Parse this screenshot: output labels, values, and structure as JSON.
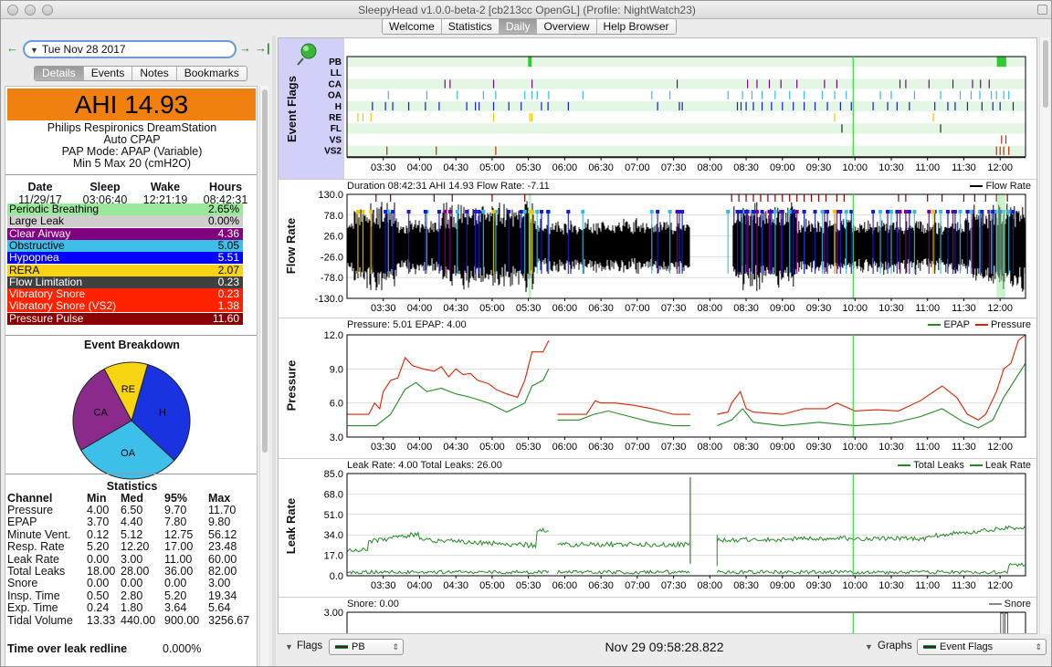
{
  "window": {
    "title": "SleepyHead v1.0.0-beta-2 [cb213cc OpenGL] (Profile: NightWatch23)"
  },
  "top_tabs": [
    {
      "label": "Welcome",
      "active": false
    },
    {
      "label": "Statistics",
      "active": false
    },
    {
      "label": "Daily",
      "active": true
    },
    {
      "label": "Overview",
      "active": false
    },
    {
      "label": "Help Browser",
      "active": false
    }
  ],
  "nav": {
    "date": "Tue Nov 28 2017",
    "back_icon": "arrow-left-icon",
    "forward_icon": "arrow-right-icon",
    "last_icon": "arrow-to-end-icon"
  },
  "left_tabs": [
    {
      "label": "Details",
      "active": true
    },
    {
      "label": "Events",
      "active": false
    },
    {
      "label": "Notes",
      "active": false
    },
    {
      "label": "Bookmarks",
      "active": false
    }
  ],
  "summary": {
    "ahi": "AHI 14.93",
    "ahi_color": "#f08010",
    "machine": "Philips Respironics DreamStation",
    "mode_type": "Auto CPAP",
    "pap_mode": "PAP Mode: APAP (Variable)",
    "pressure_range": "Min 5 Max 20 (cmH2O)"
  },
  "session": {
    "headers": [
      "Date",
      "Sleep",
      "Wake",
      "Hours"
    ],
    "values": [
      "11/29/17",
      "03:06:40",
      "12:21:19",
      "08:42:31"
    ]
  },
  "events": [
    {
      "label": "Periodic Breathing",
      "value": "2.65%",
      "bg": "#9ae89a",
      "fg": "#000000"
    },
    {
      "label": "Large Leak",
      "value": "0.00%",
      "bg": "#cfcfcf",
      "fg": "#000000"
    },
    {
      "label": "Clear Airway",
      "value": "4.36",
      "bg": "#800080",
      "fg": "#ffffff"
    },
    {
      "label": "Obstructive",
      "value": "5.05",
      "bg": "#3cbfe8",
      "fg": "#000000"
    },
    {
      "label": "Hypopnea",
      "value": "5.51",
      "bg": "#0000ff",
      "fg": "#ffffff"
    },
    {
      "label": "RERA",
      "value": "2.07",
      "bg": "#f7d513",
      "fg": "#000000"
    },
    {
      "label": "Flow Limitation",
      "value": "0.23",
      "bg": "#404040",
      "fg": "#ffffff"
    },
    {
      "label": "Vibratory Snore",
      "value": "0.23",
      "bg": "#ff2200",
      "fg": "#ffffff"
    },
    {
      "label": "Vibratory Snore (VS2)",
      "value": "1.38",
      "bg": "#ff2200",
      "fg": "#ffffff"
    },
    {
      "label": "Pressure Pulse",
      "value": "11.60",
      "bg": "#8b0000",
      "fg": "#ffffff"
    }
  ],
  "event_breakdown": {
    "title": "Event Breakdown",
    "slices": [
      {
        "label": "H",
        "value": 5.51,
        "color": "#1a33e0"
      },
      {
        "label": "OA",
        "value": 5.05,
        "color": "#3cbfe8"
      },
      {
        "label": "CA",
        "value": 4.36,
        "color": "#8a2a8a"
      },
      {
        "label": "RE",
        "value": 2.07,
        "color": "#f7d513"
      }
    ]
  },
  "statistics": {
    "title": "Statistics",
    "headers": [
      "Channel",
      "Min",
      "Med",
      "95%",
      "Max"
    ],
    "rows": [
      [
        "Pressure",
        "4.00",
        "6.50",
        "9.70",
        "11.70"
      ],
      [
        "EPAP",
        "3.70",
        "4.40",
        "7.80",
        "9.80"
      ],
      [
        "Minute Vent.",
        "0.12",
        "5.12",
        "12.75",
        "56.12"
      ],
      [
        "Resp. Rate",
        "5.20",
        "12.20",
        "17.00",
        "23.48"
      ],
      [
        "Leak Rate",
        "0.00",
        "3.00",
        "11.00",
        "60.00"
      ],
      [
        "Total Leaks",
        "18.00",
        "28.00",
        "36.00",
        "82.00"
      ],
      [
        "Snore",
        "0.00",
        "0.00",
        "0.00",
        "3.00"
      ],
      [
        "Insp. Time",
        "0.50",
        "2.80",
        "5.20",
        "19.34"
      ],
      [
        "Exp. Time",
        "0.24",
        "1.80",
        "3.64",
        "5.64"
      ],
      [
        "Tidal Volume",
        "13.33",
        "440.00",
        "900.00",
        "3256.67"
      ]
    ],
    "leak_redline_label": "Time over leak redline",
    "leak_redline_value": "0.000%"
  },
  "time_axis": [
    "03:30",
    "04:00",
    "04:30",
    "05:00",
    "05:30",
    "06:00",
    "06:30",
    "07:00",
    "07:30",
    "08:00",
    "08:30",
    "09:00",
    "09:30",
    "10:00",
    "10:30",
    "11:00",
    "11:30",
    "12:00"
  ],
  "event_flags": {
    "title": "Event Flags",
    "pin_icon": "pushpin-icon",
    "rows": [
      {
        "label": "PB",
        "color": "#33cc33",
        "times": [
          5.52,
          11.98,
          12.02,
          12.06
        ]
      },
      {
        "label": "LL",
        "color": "#888888",
        "times": []
      },
      {
        "label": "CA",
        "color": "#800080",
        "times": [
          4.35,
          4.42,
          5.02,
          5.55,
          7.55,
          8.52,
          8.65,
          8.82,
          8.98,
          9.2,
          9.58,
          9.75,
          10.62,
          10.7,
          11.02,
          11.35,
          11.62,
          11.73,
          11.85
        ]
      },
      {
        "label": "OA",
        "color": "#33bbe0",
        "times": [
          3.57,
          4.1,
          4.52,
          4.88,
          5.05,
          5.45,
          5.55,
          5.62,
          5.78,
          6.25,
          7.2,
          7.45,
          8.25,
          8.45,
          8.58,
          8.72,
          8.9,
          9.1,
          9.3,
          9.55,
          9.72,
          9.88,
          10.35,
          10.5,
          10.82,
          11.18,
          11.45,
          11.6,
          11.72,
          11.88,
          11.95,
          12.05,
          12.12
        ]
      },
      {
        "label": "H",
        "color": "#1a1acc",
        "times": [
          3.35,
          3.53,
          3.63,
          3.85,
          4.08,
          4.27,
          4.65,
          4.77,
          4.82,
          5.02,
          5.23,
          5.4,
          5.68,
          5.77,
          6.05,
          7.28,
          7.58,
          7.62,
          8.38,
          8.43,
          8.5,
          8.6,
          8.72,
          8.85,
          9.0,
          9.15,
          9.3,
          9.45,
          9.62,
          9.8,
          9.95,
          10.25,
          10.45,
          10.58,
          10.75,
          11.1,
          11.28,
          11.38,
          11.55,
          11.75,
          11.9,
          12.0,
          12.18
        ]
      },
      {
        "label": "RE",
        "color": "#e8c800",
        "times": [
          3.15,
          3.22,
          3.33,
          5.02,
          5.52,
          5.55,
          9.72,
          11.08
        ]
      },
      {
        "label": "FL",
        "color": "#222222",
        "times": [
          9.82,
          11.18
        ]
      },
      {
        "label": "VS",
        "color": "#dd2200",
        "times": [
          12.02,
          12.08
        ]
      },
      {
        "label": "VS2",
        "color": "#cc2200",
        "times": [
          3.55,
          4.23,
          5.05,
          11.95,
          12.0,
          12.05,
          12.12
        ]
      }
    ]
  },
  "flow_rate": {
    "title": "Flow Rate",
    "header": "Duration 08:42:31 AHI 14.93 Flow Rate: -7.11",
    "legend": "Flow Rate",
    "legend_color": "#000000",
    "y_ticks": [
      "130.0",
      "78.0",
      "26.0",
      "-26.0",
      "-78.0",
      "-130.0"
    ]
  },
  "pressure": {
    "title": "Pressure",
    "header": "Pressure: 5.01 EPAP: 4.00",
    "legend_epap": "EPAP",
    "legend_pressure": "Pressure",
    "epap_color": "#228b22",
    "pressure_color": "#dd2200",
    "y_ticks": [
      "12.0",
      "9.0",
      "6.0",
      "3.0"
    ]
  },
  "leak_rate": {
    "title": "Leak Rate",
    "header": "Leak Rate: 4.00 Total Leaks: 26.00",
    "legend_total": "Total Leaks",
    "legend_leak": "Leak Rate",
    "color": "#228b22",
    "y_ticks": [
      "85.0",
      "68.0",
      "51.0",
      "34.0",
      "17.0",
      "0.0"
    ]
  },
  "snore": {
    "title": "Snore",
    "header": "Snore: 0.00",
    "legend": "Snore",
    "legend_color": "#888888",
    "y_ticks": [
      "3.00"
    ]
  },
  "bottom": {
    "flags_label": "Flags",
    "flags_value": "PB",
    "current_time": "Nov 29 09:58:28.822",
    "graphs_label": "Graphs",
    "graphs_value": "Event Flags"
  }
}
